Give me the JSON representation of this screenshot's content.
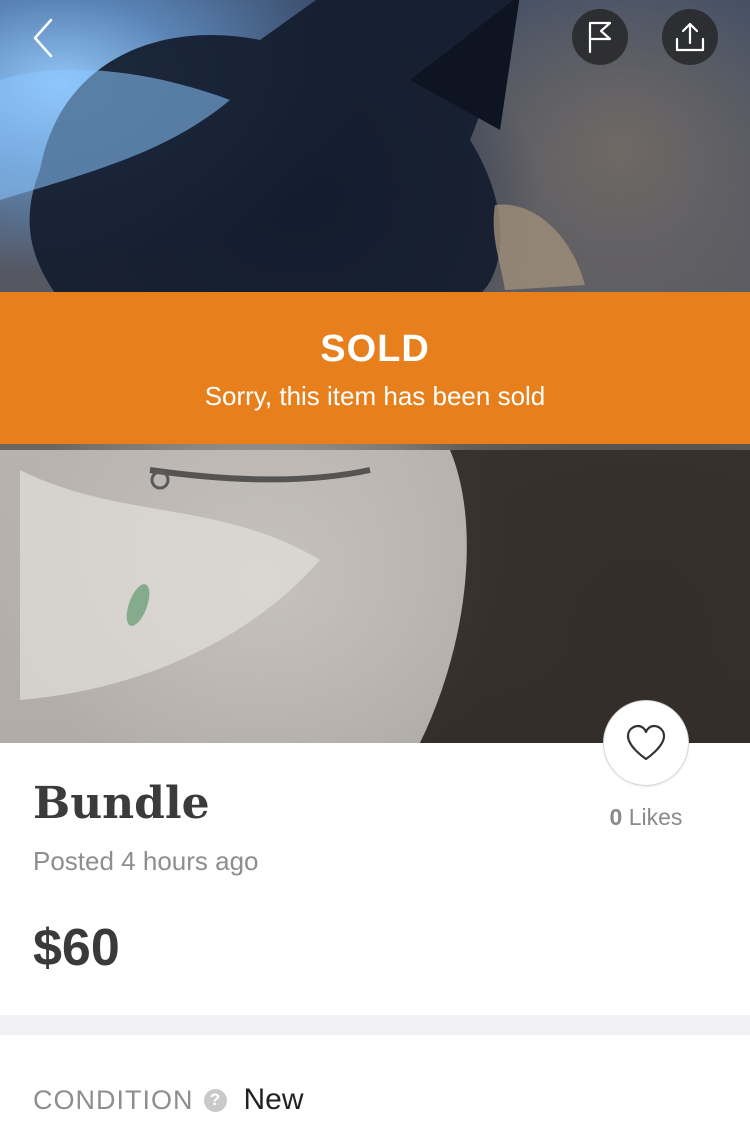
{
  "nav": {
    "back_icon": "chevron-left-icon",
    "report_icon": "flag-icon",
    "share_icon": "share-upload-icon"
  },
  "banner": {
    "title": "SOLD",
    "subtitle": "Sorry, this item has been sold",
    "color": "#e7801c"
  },
  "listing": {
    "title": "Bundle",
    "posted": "Posted 4 hours ago",
    "price": "$60"
  },
  "likes": {
    "count": "0",
    "label": "Likes",
    "icon": "heart-icon"
  },
  "details": {
    "condition_label": "CONDITION",
    "condition_help": "?",
    "condition_value": "New"
  }
}
